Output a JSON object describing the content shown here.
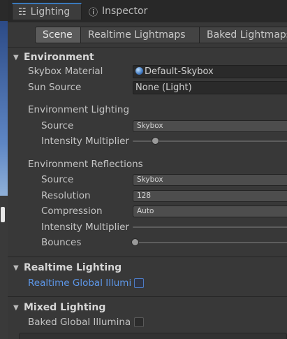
{
  "tabs": [
    {
      "label": "Lighting",
      "icon": "lighting-icon"
    },
    {
      "label": "Inspector",
      "icon": "info-icon"
    }
  ],
  "modes": [
    "Scene",
    "Realtime Lightmaps",
    "Baked Lightmaps"
  ],
  "environment": {
    "header": "Environment",
    "skybox_label": "Skybox Material",
    "skybox_value": "Default-Skybox",
    "sun_label": "Sun Source",
    "sun_value": "None (Light)",
    "env_lighting": {
      "title": "Environment Lighting",
      "source_label": "Source",
      "source_value": "Skybox",
      "intensity_label": "Intensity Multiplier",
      "intensity_value": 1
    },
    "env_reflections": {
      "title": "Environment Reflections",
      "source_label": "Source",
      "source_value": "Skybox",
      "resolution_label": "Resolution",
      "resolution_value": "128",
      "compression_label": "Compression",
      "compression_value": "Auto",
      "intensity_label": "Intensity Multiplier",
      "bounces_label": "Bounces",
      "bounces_value": 1
    }
  },
  "realtime": {
    "header": "Realtime Lighting",
    "gi_label": "Realtime Global Illumi"
  },
  "mixed": {
    "header": "Mixed Lighting",
    "baked_label": "Baked Global Illumina"
  },
  "colors": {
    "accent": "#3a79bb",
    "link_blue": "#5d97e8",
    "panel": "#383838"
  }
}
